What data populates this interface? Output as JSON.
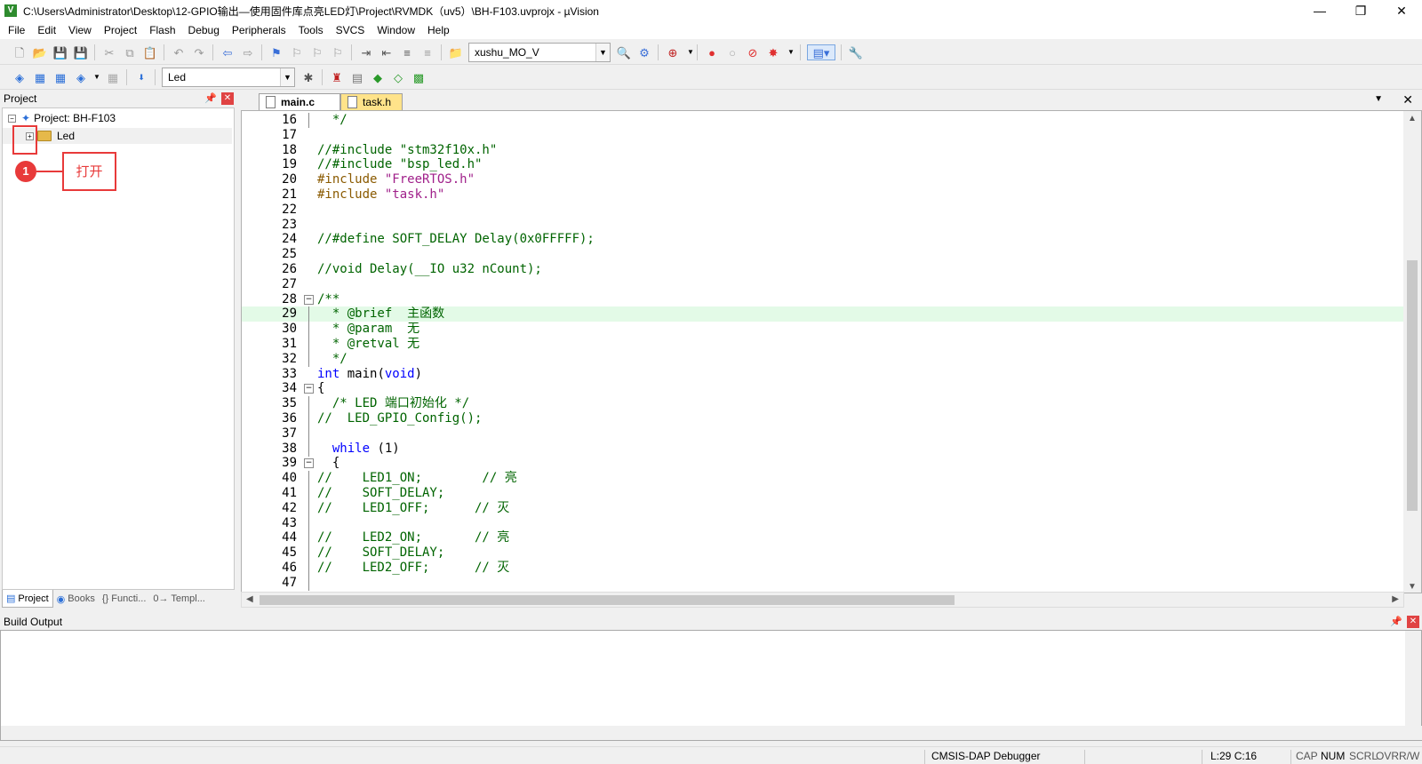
{
  "window": {
    "title": "C:\\Users\\Administrator\\Desktop\\12-GPIO输出—使用固件库点亮LED灯\\Project\\RVMDK（uv5）\\BH-F103.uvprojx - µVision",
    "minimize": "—",
    "restore": "❐",
    "close": "✕"
  },
  "menu": [
    "File",
    "Edit",
    "View",
    "Project",
    "Flash",
    "Debug",
    "Peripherals",
    "Tools",
    "SVCS",
    "Window",
    "Help"
  ],
  "toolbar1": {
    "target_combo": "xushu_MO_V"
  },
  "toolbar2": {
    "target_select": "Led"
  },
  "project_panel": {
    "title": "Project",
    "root": "Project: BH-F103",
    "group": "Led",
    "callout_number": "1",
    "callout_text": "打开",
    "tabs": [
      "Project",
      "Books",
      "{} Functi...",
      "0→ Templ..."
    ]
  },
  "editor": {
    "tabs": [
      {
        "label": "main.c",
        "active": true
      },
      {
        "label": "task.h",
        "active": false
      }
    ],
    "highlight_line": 29,
    "lines": [
      {
        "n": "16",
        "text": "  */"
      },
      {
        "n": "17",
        "text": ""
      },
      {
        "n": "18",
        "text": "//#include \"stm32f10x.h\""
      },
      {
        "n": "19",
        "text": "//#include \"bsp_led.h\""
      },
      {
        "n": "20",
        "text": "#include \"FreeRTOS.h\""
      },
      {
        "n": "21",
        "text": "#include \"task.h\""
      },
      {
        "n": "22",
        "text": ""
      },
      {
        "n": "23",
        "text": ""
      },
      {
        "n": "24",
        "text": "//#define SOFT_DELAY Delay(0x0FFFFF);"
      },
      {
        "n": "25",
        "text": ""
      },
      {
        "n": "26",
        "text": "//void Delay(__IO u32 nCount);"
      },
      {
        "n": "27",
        "text": ""
      },
      {
        "n": "28",
        "text": "/**"
      },
      {
        "n": "29",
        "text": "  * @brief  主函数"
      },
      {
        "n": "30",
        "text": "  * @param  无"
      },
      {
        "n": "31",
        "text": "  * @retval 无"
      },
      {
        "n": "32",
        "text": "  */"
      },
      {
        "n": "33",
        "text": "int main(void)"
      },
      {
        "n": "34",
        "text": "{"
      },
      {
        "n": "35",
        "text": "  /* LED 端口初始化 */"
      },
      {
        "n": "36",
        "text": "//  LED_GPIO_Config();"
      },
      {
        "n": "37",
        "text": ""
      },
      {
        "n": "38",
        "text": "  while (1)"
      },
      {
        "n": "39",
        "text": "  {"
      },
      {
        "n": "40",
        "text": "//    LED1_ON;        // 亮"
      },
      {
        "n": "41",
        "text": "//    SOFT_DELAY;"
      },
      {
        "n": "42",
        "text": "//    LED1_OFF;      // 灭"
      },
      {
        "n": "43",
        "text": ""
      },
      {
        "n": "44",
        "text": "//    LED2_ON;       // 亮"
      },
      {
        "n": "45",
        "text": "//    SOFT_DELAY;"
      },
      {
        "n": "46",
        "text": "//    LED2_OFF;      // 灭"
      },
      {
        "n": "47",
        "text": ""
      }
    ]
  },
  "build_output": {
    "title": "Build Output"
  },
  "status": {
    "debugger": "CMSIS-DAP Debugger",
    "position": "L:29 C:16",
    "cap": "CAP",
    "num": "NUM",
    "scrl": "SCRL",
    "ovr": "OVR",
    "rw": "R/W"
  },
  "colors": {
    "accent_red": "#e83a3a",
    "highlight_line": "#e3fae7",
    "keyword": "#0000ff",
    "comment": "#006400",
    "string": "#a0208a"
  }
}
